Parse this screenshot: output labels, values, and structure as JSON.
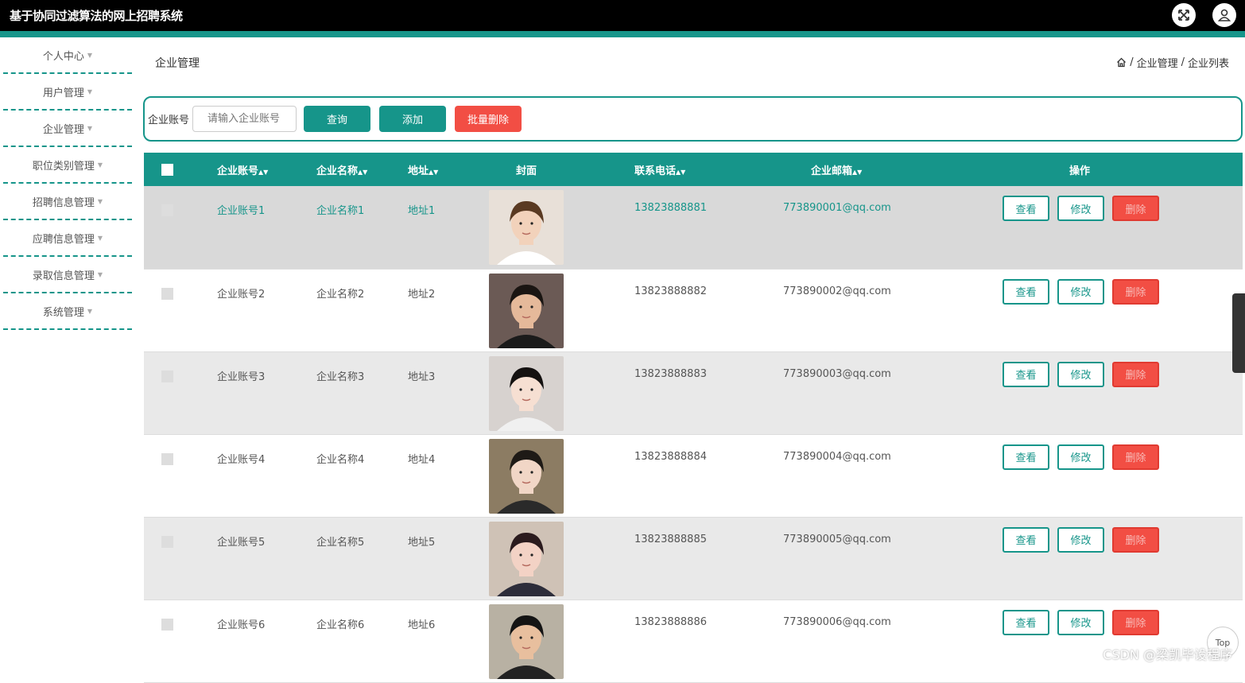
{
  "app": {
    "title": "基于协同过滤算法的网上招聘系统"
  },
  "sidebar": {
    "items": [
      {
        "label": "个人中心"
      },
      {
        "label": "用户管理"
      },
      {
        "label": "企业管理"
      },
      {
        "label": "职位类别管理"
      },
      {
        "label": "招聘信息管理"
      },
      {
        "label": "应聘信息管理"
      },
      {
        "label": "录取信息管理"
      },
      {
        "label": "系统管理"
      }
    ]
  },
  "page": {
    "title": "企业管理",
    "breadcrumb": [
      "企业管理",
      "企业列表"
    ]
  },
  "search": {
    "label": "企业账号",
    "placeholder": "请输入企业账号",
    "query_label": "查询",
    "add_label": "添加",
    "batch_delete_label": "批量删除"
  },
  "table": {
    "headers": {
      "account": "企业账号",
      "name": "企业名称",
      "address": "地址",
      "cover": "封面",
      "phone": "联系电话",
      "email": "企业邮箱",
      "ops": "操作"
    },
    "ops": {
      "view": "查看",
      "edit": "修改",
      "delete": "删除"
    },
    "rows": [
      {
        "account": "企业账号1",
        "name": "企业名称1",
        "address": "地址1",
        "phone": "13823888881",
        "email": "773890001@qq.com"
      },
      {
        "account": "企业账号2",
        "name": "企业名称2",
        "address": "地址2",
        "phone": "13823888882",
        "email": "773890002@qq.com"
      },
      {
        "account": "企业账号3",
        "name": "企业名称3",
        "address": "地址3",
        "phone": "13823888883",
        "email": "773890003@qq.com"
      },
      {
        "account": "企业账号4",
        "name": "企业名称4",
        "address": "地址4",
        "phone": "13823888884",
        "email": "773890004@qq.com"
      },
      {
        "account": "企业账号5",
        "name": "企业名称5",
        "address": "地址5",
        "phone": "13823888885",
        "email": "773890005@qq.com"
      },
      {
        "account": "企业账号6",
        "name": "企业名称6",
        "address": "地址6",
        "phone": "13823888886",
        "email": "773890006@qq.com"
      }
    ]
  },
  "overlay": {
    "watermark": "CSDN @梁凯毕设程序",
    "top_link": "Top"
  },
  "colors": {
    "accent": "#16958a",
    "danger": "#f24e44"
  }
}
